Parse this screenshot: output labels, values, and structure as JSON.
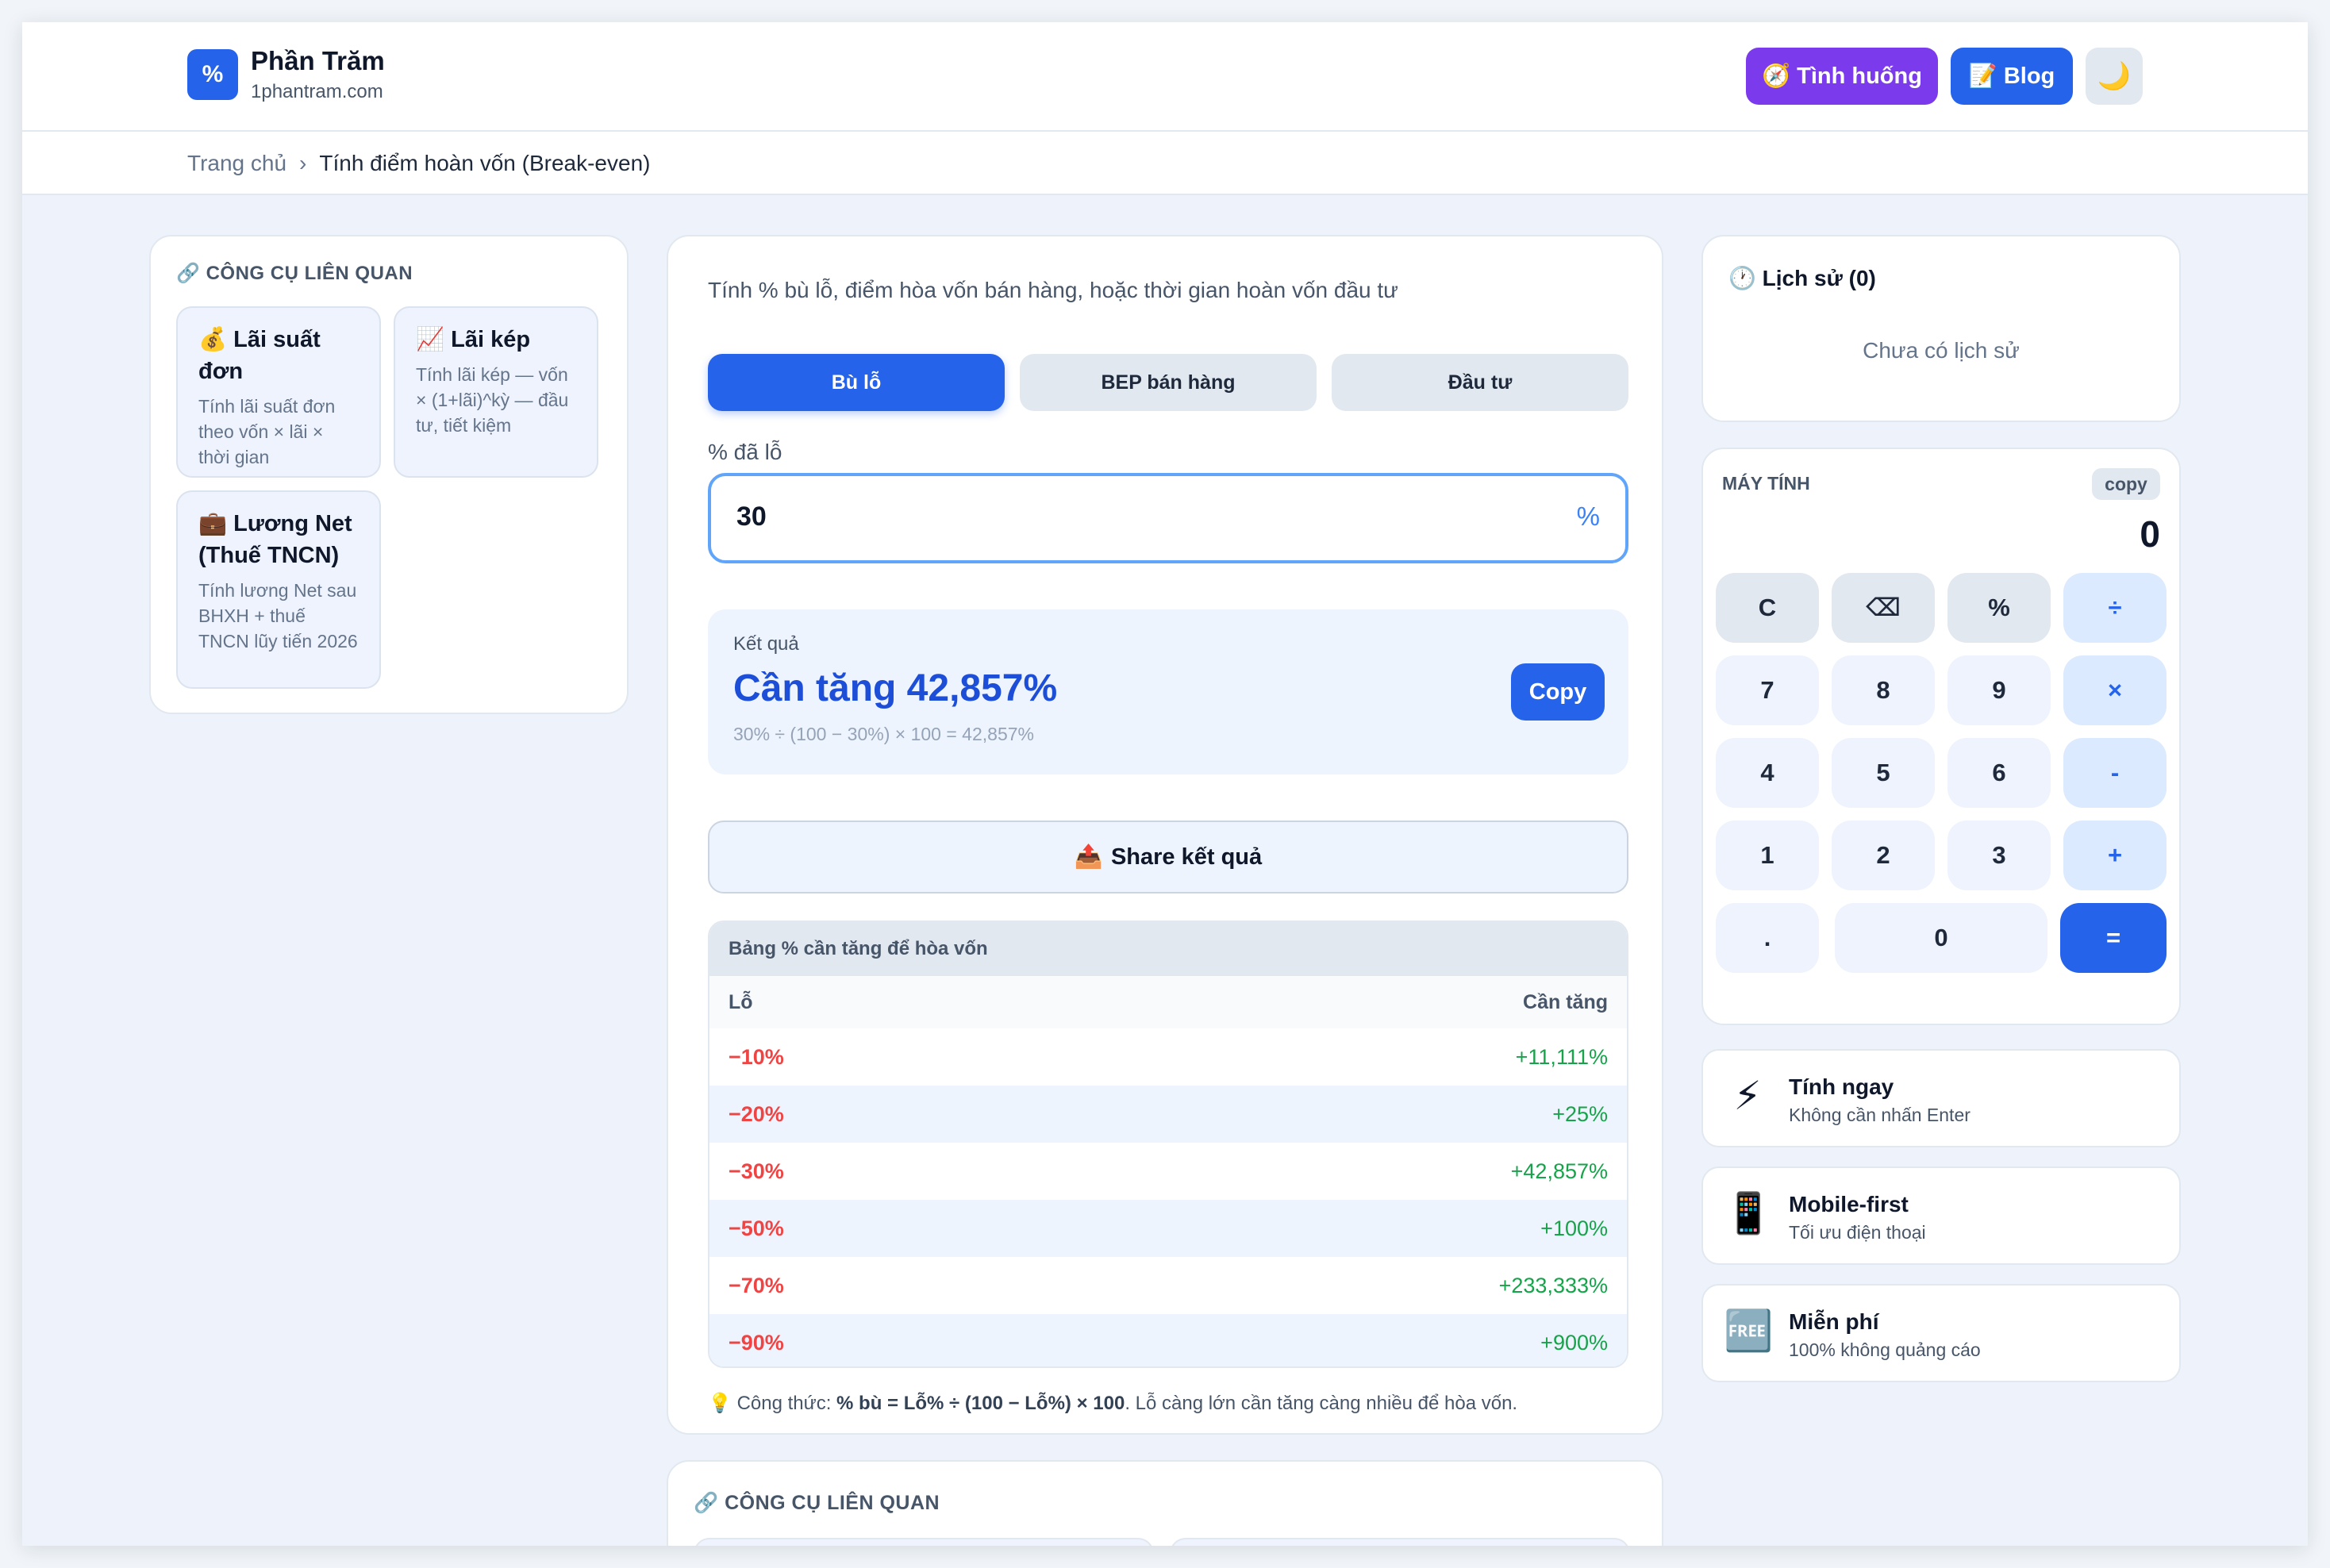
{
  "brand": {
    "logo_symbol": "%",
    "title": "Phần Trăm",
    "subtitle": "1phantram.com"
  },
  "header": {
    "scenarios_icon": "🧭",
    "scenarios_label": "Tình huống",
    "blog_icon": "📝",
    "blog_label": "Blog",
    "theme_icon": "🌙"
  },
  "breadcrumb": {
    "home": "Trang chủ",
    "separator": "›",
    "current": "Tính điểm hoàn vốn (Break-even)"
  },
  "related_left": {
    "icon": "🔗",
    "heading": "CÔNG CỤ LIÊN QUAN",
    "tools": [
      {
        "title": "💰 Lãi suất đơn",
        "desc": "Tính lãi suất đơn theo vốn × lãi × thời gian"
      },
      {
        "title": "📈 Lãi kép",
        "desc": "Tính lãi kép — vốn × (1+lãi)^kỳ — đầu tư, tiết kiệm"
      },
      {
        "title": "💼 Lương Net (Thuế TNCN)",
        "desc": "Tính lương Net sau BHXH + thuế TNCN lũy tiến 2026"
      }
    ]
  },
  "calculator_main": {
    "intro": "Tính % bù lỗ, điểm hòa vốn bán hàng, hoặc thời gian hoàn vốn đầu tư",
    "tabs": [
      {
        "label": "Bù lỗ",
        "active": true
      },
      {
        "label": "BEP bán hàng",
        "active": false
      },
      {
        "label": "Đầu tư",
        "active": false
      }
    ],
    "field_label": "% đã lỗ",
    "field_value": "30",
    "field_unit": "%",
    "result_label": "Kết quả",
    "result_value": "Cần tăng 42,857%",
    "result_formula": "30% ÷ (100 − 30%) × 100 = 42,857%",
    "copy_label": "Copy",
    "share_icon": "📤",
    "share_label": "Share kết quả",
    "table": {
      "caption": "Bảng % cần tăng để hòa vốn",
      "col_loss": "Lỗ",
      "col_gain": "Cần tăng",
      "rows": [
        {
          "loss": "−10%",
          "gain": "+11,111%"
        },
        {
          "loss": "−20%",
          "gain": "+25%"
        },
        {
          "loss": "−30%",
          "gain": "+42,857%"
        },
        {
          "loss": "−50%",
          "gain": "+100%"
        },
        {
          "loss": "−70%",
          "gain": "+233,333%"
        },
        {
          "loss": "−90%",
          "gain": "+900%"
        }
      ]
    },
    "note_icon": "💡",
    "note_prefix": "Công thức: ",
    "note_formula": "% bù = Lỗ% ÷ (100 − Lỗ%) × 100",
    "note_suffix": ". Lỗ càng lớn cần tăng càng nhiều để hòa vốn."
  },
  "related_bottom": {
    "icon": "🔗",
    "heading": "CÔNG CỤ LIÊN QUAN"
  },
  "history": {
    "icon": "🕐",
    "title": "Lịch sử (0)",
    "empty": "Chưa có lịch sử"
  },
  "mini_calc": {
    "label": "MÁY TÍNH",
    "copy_label": "copy",
    "display": "0",
    "keys": [
      "C",
      "⌫",
      "%",
      "÷",
      "7",
      "8",
      "9",
      "×",
      "4",
      "5",
      "6",
      "-",
      "1",
      "2",
      "3",
      "+",
      ".",
      "0",
      "="
    ]
  },
  "features": [
    {
      "icon": "⚡",
      "title": "Tính ngay",
      "desc": "Không cần nhấn Enter"
    },
    {
      "icon": "📱",
      "title": "Mobile-first",
      "desc": "Tối ưu điện thoại"
    },
    {
      "icon": "🆓",
      "title": "Miễn phí",
      "desc": "100% không quảng cáo"
    }
  ],
  "colors": {
    "primary": "#2563eb",
    "scenario_button": "#7c3aed",
    "loss": "#ef4444",
    "gain": "#16a34a",
    "page_bg": "#edf2fb"
  }
}
